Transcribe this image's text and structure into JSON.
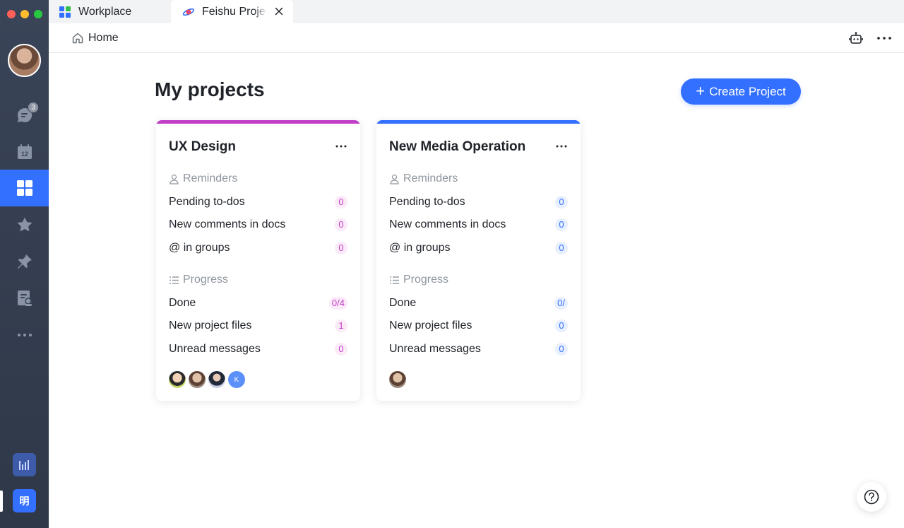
{
  "tabs": [
    {
      "label": "Workplace"
    },
    {
      "label": "Feishu Project"
    }
  ],
  "header": {
    "home_label": "Home"
  },
  "sidebar": {
    "messages_badge": "3",
    "calendar_day": "12",
    "app_label": "明"
  },
  "main": {
    "title": "My projects",
    "create_label": "Create Project"
  },
  "labels": {
    "reminders": "Reminders",
    "progress": "Progress",
    "pending_todos": "Pending to-dos",
    "new_comments": "New comments in docs",
    "at_groups": "@ in groups",
    "done": "Done",
    "new_files": "New project files",
    "unread": "Unread messages"
  },
  "projects": [
    {
      "name": "UX Design",
      "accent": "#c23fc8",
      "pending_todos": "0",
      "new_comments": "0",
      "at_groups": "0",
      "done": "0/4",
      "new_files": "1",
      "unread": "0",
      "member_initial": "K"
    },
    {
      "name": "New Media Operation",
      "accent": "#3370ff",
      "pending_todos": "0",
      "new_comments": "0",
      "at_groups": "0",
      "done": "0/",
      "new_files": "0",
      "unread": "0"
    }
  ],
  "colors": {
    "sidebar_bg": "#3a4458",
    "primary": "#3370ff"
  }
}
